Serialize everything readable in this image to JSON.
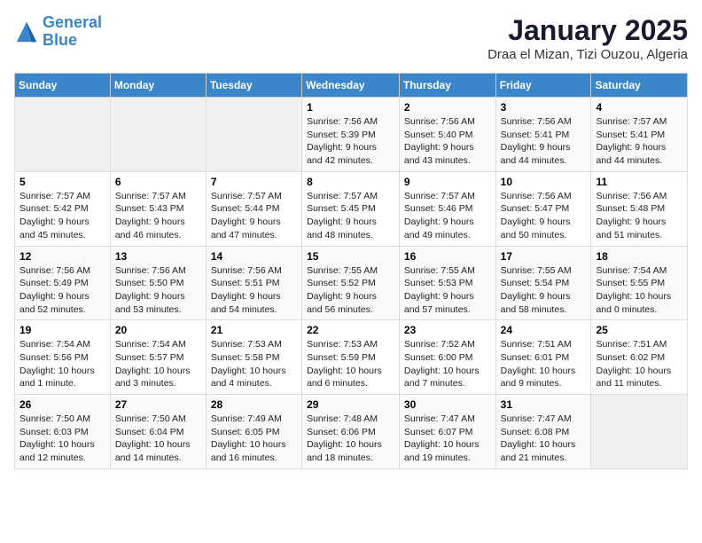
{
  "logo": {
    "line1": "General",
    "line2": "Blue"
  },
  "title": "January 2025",
  "location": "Draa el Mizan, Tizi Ouzou, Algeria",
  "weekdays": [
    "Sunday",
    "Monday",
    "Tuesday",
    "Wednesday",
    "Thursday",
    "Friday",
    "Saturday"
  ],
  "weeks": [
    [
      {
        "day": "",
        "info": ""
      },
      {
        "day": "",
        "info": ""
      },
      {
        "day": "",
        "info": ""
      },
      {
        "day": "1",
        "info": "Sunrise: 7:56 AM\nSunset: 5:39 PM\nDaylight: 9 hours and 42 minutes."
      },
      {
        "day": "2",
        "info": "Sunrise: 7:56 AM\nSunset: 5:40 PM\nDaylight: 9 hours and 43 minutes."
      },
      {
        "day": "3",
        "info": "Sunrise: 7:56 AM\nSunset: 5:41 PM\nDaylight: 9 hours and 44 minutes."
      },
      {
        "day": "4",
        "info": "Sunrise: 7:57 AM\nSunset: 5:41 PM\nDaylight: 9 hours and 44 minutes."
      }
    ],
    [
      {
        "day": "5",
        "info": "Sunrise: 7:57 AM\nSunset: 5:42 PM\nDaylight: 9 hours and 45 minutes."
      },
      {
        "day": "6",
        "info": "Sunrise: 7:57 AM\nSunset: 5:43 PM\nDaylight: 9 hours and 46 minutes."
      },
      {
        "day": "7",
        "info": "Sunrise: 7:57 AM\nSunset: 5:44 PM\nDaylight: 9 hours and 47 minutes."
      },
      {
        "day": "8",
        "info": "Sunrise: 7:57 AM\nSunset: 5:45 PM\nDaylight: 9 hours and 48 minutes."
      },
      {
        "day": "9",
        "info": "Sunrise: 7:57 AM\nSunset: 5:46 PM\nDaylight: 9 hours and 49 minutes."
      },
      {
        "day": "10",
        "info": "Sunrise: 7:56 AM\nSunset: 5:47 PM\nDaylight: 9 hours and 50 minutes."
      },
      {
        "day": "11",
        "info": "Sunrise: 7:56 AM\nSunset: 5:48 PM\nDaylight: 9 hours and 51 minutes."
      }
    ],
    [
      {
        "day": "12",
        "info": "Sunrise: 7:56 AM\nSunset: 5:49 PM\nDaylight: 9 hours and 52 minutes."
      },
      {
        "day": "13",
        "info": "Sunrise: 7:56 AM\nSunset: 5:50 PM\nDaylight: 9 hours and 53 minutes."
      },
      {
        "day": "14",
        "info": "Sunrise: 7:56 AM\nSunset: 5:51 PM\nDaylight: 9 hours and 54 minutes."
      },
      {
        "day": "15",
        "info": "Sunrise: 7:55 AM\nSunset: 5:52 PM\nDaylight: 9 hours and 56 minutes."
      },
      {
        "day": "16",
        "info": "Sunrise: 7:55 AM\nSunset: 5:53 PM\nDaylight: 9 hours and 57 minutes."
      },
      {
        "day": "17",
        "info": "Sunrise: 7:55 AM\nSunset: 5:54 PM\nDaylight: 9 hours and 58 minutes."
      },
      {
        "day": "18",
        "info": "Sunrise: 7:54 AM\nSunset: 5:55 PM\nDaylight: 10 hours and 0 minutes."
      }
    ],
    [
      {
        "day": "19",
        "info": "Sunrise: 7:54 AM\nSunset: 5:56 PM\nDaylight: 10 hours and 1 minute."
      },
      {
        "day": "20",
        "info": "Sunrise: 7:54 AM\nSunset: 5:57 PM\nDaylight: 10 hours and 3 minutes."
      },
      {
        "day": "21",
        "info": "Sunrise: 7:53 AM\nSunset: 5:58 PM\nDaylight: 10 hours and 4 minutes."
      },
      {
        "day": "22",
        "info": "Sunrise: 7:53 AM\nSunset: 5:59 PM\nDaylight: 10 hours and 6 minutes."
      },
      {
        "day": "23",
        "info": "Sunrise: 7:52 AM\nSunset: 6:00 PM\nDaylight: 10 hours and 7 minutes."
      },
      {
        "day": "24",
        "info": "Sunrise: 7:51 AM\nSunset: 6:01 PM\nDaylight: 10 hours and 9 minutes."
      },
      {
        "day": "25",
        "info": "Sunrise: 7:51 AM\nSunset: 6:02 PM\nDaylight: 10 hours and 11 minutes."
      }
    ],
    [
      {
        "day": "26",
        "info": "Sunrise: 7:50 AM\nSunset: 6:03 PM\nDaylight: 10 hours and 12 minutes."
      },
      {
        "day": "27",
        "info": "Sunrise: 7:50 AM\nSunset: 6:04 PM\nDaylight: 10 hours and 14 minutes."
      },
      {
        "day": "28",
        "info": "Sunrise: 7:49 AM\nSunset: 6:05 PM\nDaylight: 10 hours and 16 minutes."
      },
      {
        "day": "29",
        "info": "Sunrise: 7:48 AM\nSunset: 6:06 PM\nDaylight: 10 hours and 18 minutes."
      },
      {
        "day": "30",
        "info": "Sunrise: 7:47 AM\nSunset: 6:07 PM\nDaylight: 10 hours and 19 minutes."
      },
      {
        "day": "31",
        "info": "Sunrise: 7:47 AM\nSunset: 6:08 PM\nDaylight: 10 hours and 21 minutes."
      },
      {
        "day": "",
        "info": ""
      }
    ]
  ]
}
